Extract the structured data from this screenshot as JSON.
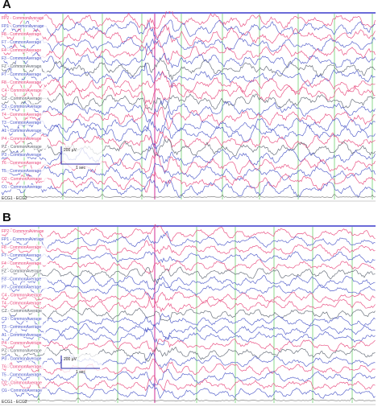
{
  "panels": [
    {
      "label": "A",
      "channels": [
        {
          "name": "FP2 - CommonAverage",
          "color": "pink"
        },
        {
          "name": "FP1 - CommonAverage",
          "color": "blue"
        },
        {
          "name": "F8 - CommonAverage",
          "color": "pink"
        },
        {
          "name": "F7 - CommonAverage",
          "color": "blue"
        },
        {
          "name": "F4 - CommonAverage",
          "color": "pink"
        },
        {
          "name": "F3 - CommonAverage",
          "color": "blue"
        },
        {
          "name": "FZ - CommonAverage",
          "color": "gray"
        },
        {
          "name": "F7 - CommonAverage",
          "color": "blue"
        },
        {
          "name": "F8 - CommonAverage",
          "color": "pink"
        },
        {
          "name": "C4 - CommonAverage",
          "color": "pink"
        },
        {
          "name": "CZ - CommonAverage",
          "color": "gray"
        },
        {
          "name": "C3 - CommonAverage",
          "color": "blue"
        },
        {
          "name": "T4 - CommonAverage",
          "color": "pink"
        },
        {
          "name": "T3 - CommonAverage",
          "color": "blue"
        },
        {
          "name": "A1 - CommonAverage",
          "color": "blue"
        },
        {
          "name": "P4 - CommonAverage",
          "color": "pink"
        },
        {
          "name": "PZ - CommonAverage",
          "color": "gray"
        },
        {
          "name": "P3 - CommonAverage",
          "color": "blue"
        },
        {
          "name": "T6 - CommonAverage",
          "color": "pink"
        },
        {
          "name": "T5 - CommonAverage",
          "color": "blue"
        },
        {
          "name": "O2 - CommonAverage",
          "color": "pink"
        },
        {
          "name": "O1 - CommonAverage",
          "color": "blue"
        }
      ],
      "footer": "ECG1 - ECG2",
      "scale_amplitude": "200 µV",
      "scale_time": "1 sec",
      "amplitude": 1.0
    },
    {
      "label": "B",
      "channels": [
        {
          "name": "FP2 - CommonAverage",
          "color": "pink"
        },
        {
          "name": "FP1 - CommonAverage",
          "color": "blue"
        },
        {
          "name": "F8 - CommonAverage",
          "color": "pink"
        },
        {
          "name": "F7 - CommonAverage",
          "color": "blue"
        },
        {
          "name": "F4 - CommonAverage",
          "color": "pink"
        },
        {
          "name": "FZ - CommonAverage",
          "color": "gray"
        },
        {
          "name": "F3 - CommonAverage",
          "color": "blue"
        },
        {
          "name": "F7 - CommonAverage",
          "color": "blue"
        },
        {
          "name": "C4 - CommonAverage",
          "color": "pink"
        },
        {
          "name": "T4 - CommonAverage",
          "color": "pink"
        },
        {
          "name": "CZ - CommonAverage",
          "color": "gray"
        },
        {
          "name": "C3 - CommonAverage",
          "color": "blue"
        },
        {
          "name": "T3 - CommonAverage",
          "color": "blue"
        },
        {
          "name": "A1 - CommonAverage",
          "color": "blue"
        },
        {
          "name": "P4 - CommonAverage",
          "color": "pink"
        },
        {
          "name": "PZ - CommonAverage",
          "color": "gray"
        },
        {
          "name": "P3 - CommonAverage",
          "color": "blue"
        },
        {
          "name": "T6 - CommonAverage",
          "color": "pink"
        },
        {
          "name": "T5 - CommonAverage",
          "color": "blue"
        },
        {
          "name": "O2 - CommonAverage",
          "color": "pink"
        },
        {
          "name": "O1 - CommonAverage",
          "color": "blue"
        }
      ],
      "footer": "ECG1 - ECG2",
      "scale_amplitude": "200 µV",
      "scale_time": "1 sec",
      "amplitude": 0.75
    }
  ],
  "colors": {
    "pink": "#e8457a",
    "blue": "#4a56c8",
    "gray": "#5c6470",
    "top_bar": "#3a3acb",
    "gridline_green": "#7fd67f",
    "gridline_magenta": "#d94fa6",
    "scale_bar": "#2a2aa8"
  }
}
